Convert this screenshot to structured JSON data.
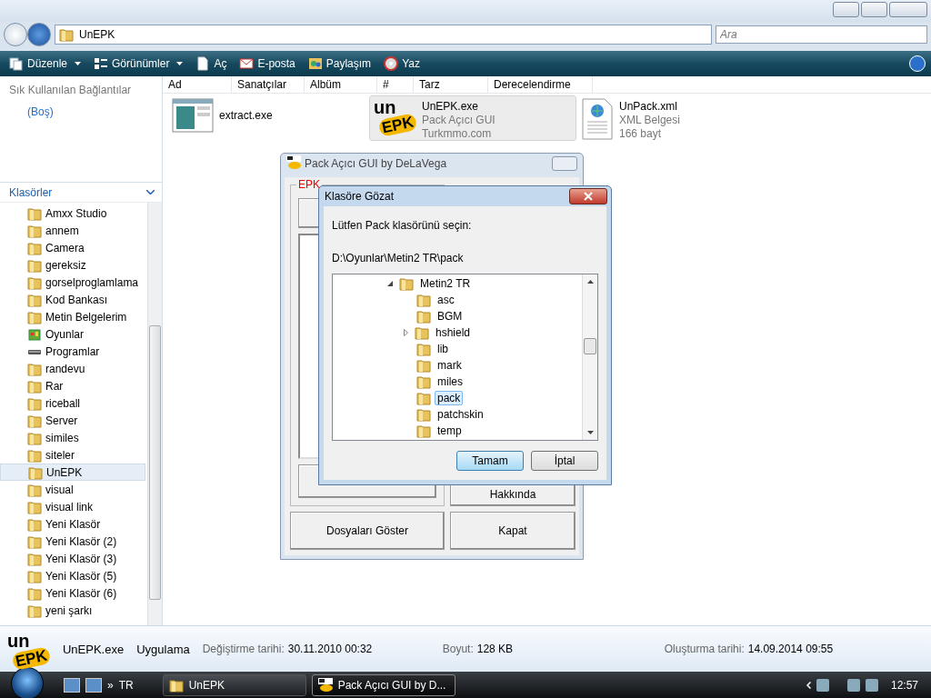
{
  "explorer": {
    "address": {
      "crumb": "UnEPK"
    },
    "search": {
      "placeholder": "Ara"
    },
    "toolbar": [
      {
        "label": "Düzenle",
        "dropdown": true,
        "kind": "organize"
      },
      {
        "label": "Görünümler",
        "dropdown": true,
        "kind": "views"
      },
      {
        "label": "Aç",
        "dropdown": false,
        "kind": "open"
      },
      {
        "label": "E-posta",
        "dropdown": false,
        "kind": "mail"
      },
      {
        "label": "Paylaşım",
        "dropdown": false,
        "kind": "share"
      },
      {
        "label": "Yaz",
        "dropdown": false,
        "kind": "burn"
      }
    ],
    "nav": {
      "favorites_title": "Sık Kullanılan Bağlantılar",
      "favorites_empty": "(Boş)",
      "folders_title": "Klasörler",
      "folders": [
        {
          "label": "Amxx Studio",
          "kind": "folder",
          "selected": false
        },
        {
          "label": "annem",
          "kind": "folder",
          "selected": false
        },
        {
          "label": "Camera",
          "kind": "folder",
          "selected": false
        },
        {
          "label": "gereksiz",
          "kind": "folder",
          "selected": false
        },
        {
          "label": "gorselproglamlama",
          "kind": "folder",
          "selected": false
        },
        {
          "label": "Kod Bankası",
          "kind": "folder",
          "selected": false
        },
        {
          "label": "Metin Belgelerim",
          "kind": "folder",
          "selected": false
        },
        {
          "label": "Oyunlar",
          "kind": "games",
          "selected": false
        },
        {
          "label": "Programlar",
          "kind": "drive",
          "selected": false
        },
        {
          "label": "randevu",
          "kind": "folder",
          "selected": false
        },
        {
          "label": "Rar",
          "kind": "folder",
          "selected": false
        },
        {
          "label": "riceball",
          "kind": "folder",
          "selected": false
        },
        {
          "label": "Server",
          "kind": "folder",
          "selected": false
        },
        {
          "label": "similes",
          "kind": "folder",
          "selected": false
        },
        {
          "label": "siteler",
          "kind": "folder",
          "selected": false
        },
        {
          "label": "UnEPK",
          "kind": "folder",
          "selected": true
        },
        {
          "label": "visual",
          "kind": "folder",
          "selected": false
        },
        {
          "label": "visual link",
          "kind": "folder",
          "selected": false
        },
        {
          "label": "Yeni Klasör",
          "kind": "folder",
          "selected": false
        },
        {
          "label": "Yeni Klasör (2)",
          "kind": "folder",
          "selected": false
        },
        {
          "label": "Yeni Klasör (3)",
          "kind": "folder",
          "selected": false
        },
        {
          "label": "Yeni Klasör (5)",
          "kind": "folder",
          "selected": false
        },
        {
          "label": "Yeni Klasör (6)",
          "kind": "folder",
          "selected": false
        },
        {
          "label": "yeni şarkı",
          "kind": "folder",
          "selected": false
        }
      ]
    },
    "columns": [
      "Ad",
      "Sanatçılar",
      "Albüm",
      "#",
      "Tarz",
      "Derecelendirme"
    ],
    "files": [
      {
        "name": "extract.exe",
        "kind": "app",
        "selected": false
      },
      {
        "name": "UnEPK.exe",
        "kind": "logo",
        "logo": [
          "un",
          "EPK"
        ],
        "lines": [
          "Pack Açıcı GUI",
          "Turkmmo.com"
        ],
        "selected": true
      },
      {
        "name": "UnPack.xml",
        "kind": "xml",
        "lines": [
          "XML Belgesi",
          "166 bayt"
        ],
        "selected": false
      }
    ],
    "details": {
      "logo": [
        "un",
        "EPK"
      ],
      "name": "UnEPK.exe",
      "type": "Uygulama",
      "fields": [
        {
          "label": "Değiştirme tarihi:",
          "value": "30.11.2010 00:32"
        },
        {
          "label": "Boyut:",
          "value": "128 KB"
        },
        {
          "label": "Oluşturma tarihi:",
          "value": "14.09.2014 09:55"
        }
      ]
    }
  },
  "app_window": {
    "title": "Pack Açıcı GUI by DeLaVega",
    "group_label": "EPK",
    "about_button": "Hakkında",
    "bottom_buttons": [
      "Dosyaları Göster",
      "Kapat"
    ]
  },
  "dialog": {
    "title": "Klasöre Gözat",
    "prompt": "Lütfen Pack klasörünü seçin:",
    "path": "D:\\Oyunlar\\Metin2 TR\\pack",
    "tree": [
      {
        "label": "Metin2 TR",
        "expanded": true,
        "selected": false,
        "children": [
          {
            "label": "asc",
            "expandable": false,
            "selected": false
          },
          {
            "label": "BGM",
            "expandable": false,
            "selected": false
          },
          {
            "label": "hshield",
            "expandable": true,
            "selected": false
          },
          {
            "label": "lib",
            "expandable": false,
            "selected": false
          },
          {
            "label": "mark",
            "expandable": false,
            "selected": false
          },
          {
            "label": "miles",
            "expandable": false,
            "selected": false
          },
          {
            "label": "pack",
            "expandable": false,
            "selected": true
          },
          {
            "label": "patchskin",
            "expandable": false,
            "selected": false
          },
          {
            "label": "temp",
            "expandable": false,
            "selected": false
          }
        ]
      }
    ],
    "buttons": [
      {
        "label": "Tamam",
        "default": true
      },
      {
        "label": "İptal",
        "default": false
      }
    ]
  },
  "taskbar": {
    "chevron": "»",
    "language": "TR",
    "tasks": [
      {
        "label": "UnEPK",
        "kind": "folder",
        "selected": false
      },
      {
        "label": "Pack Açıcı GUI by D...",
        "kind": "logo",
        "selected": true
      }
    ],
    "clock": "12:57"
  }
}
